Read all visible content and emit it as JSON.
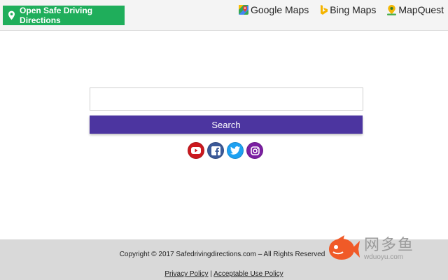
{
  "header": {
    "open_button_label": "Open Safe Driving Directions",
    "nav": [
      {
        "label": "Google Maps",
        "icon": "google-maps-icon"
      },
      {
        "label": "Bing Maps",
        "icon": "bing-icon"
      },
      {
        "label": "MapQuest",
        "icon": "mapquest-icon"
      }
    ]
  },
  "search": {
    "input_value": "",
    "placeholder": "",
    "button_label": "Search"
  },
  "social": [
    {
      "name": "youtube",
      "icon": "youtube-icon",
      "color": "#cc181e"
    },
    {
      "name": "facebook",
      "icon": "facebook-icon",
      "color": "#3b5998"
    },
    {
      "name": "twitter",
      "icon": "twitter-icon",
      "color": "#1da1f2"
    },
    {
      "name": "instagram",
      "icon": "instagram-icon",
      "color": "#7b1fa2"
    }
  ],
  "footer": {
    "copyright": "Copyright © 2017 Safedrivingdirections.com – All Rights Reserved",
    "privacy_label": "Privacy Policy",
    "separator": "|",
    "acceptable_label": "Acceptable Use Policy"
  },
  "watermark": {
    "text_cn": "网多鱼",
    "url": "wduoyu.com"
  },
  "colors": {
    "accent_green": "#1fae5b",
    "search_button": "#4c35a0",
    "footer_bg": "#d9d9d9"
  }
}
